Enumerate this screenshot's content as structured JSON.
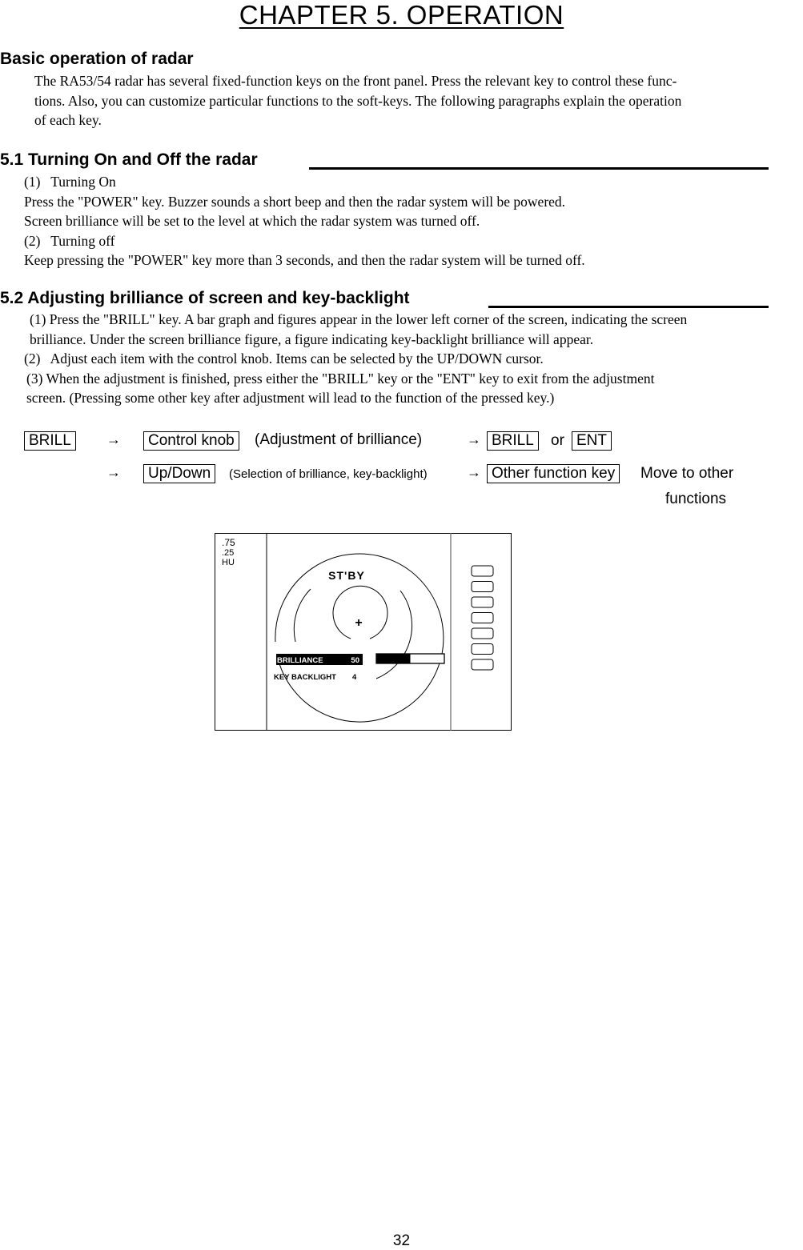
{
  "chapter_title": "CHAPTER 5.  OPERATION",
  "basic": {
    "heading": "Basic operation of radar",
    "lines": [
      "The RA53/54 radar has several fixed-function keys on the front panel. Press the relevant key to control these func-",
      "tions. Also, you can customize particular functions to the soft-keys.  The following paragraphs explain the operation",
      "of each key."
    ]
  },
  "section_5_1": {
    "heading": "5.1 Turning On and Off the radar",
    "lines": [
      "(1)   Turning On",
      "Press the \"POWER\" key. Buzzer sounds a short beep and then the radar system will be powered.",
      "Screen brilliance will be set to the level at which the radar system was turned off.",
      "(2)   Turning off",
      "Keep pressing the \"POWER\" key more than 3 seconds, and then the radar system will be turned off."
    ]
  },
  "section_5_2": {
    "heading": "5.2 Adjusting brilliance of screen and key-backlight",
    "lines": [
      "(1) Press the \"BRILL\" key. A bar graph and figures appear in the lower left corner of the screen, indicating the screen",
      "brilliance. Under the screen brilliance figure, a figure indicating key-backlight brilliance will appear.",
      "(2)   Adjust each item with the control knob. Items can be selected by the UP/DOWN cursor.",
      "(3) When the adjustment is finished, press either the \"BRILL\" key or the \"ENT\" key to exit from the adjustment",
      "screen.  (Pressing some other key after adjustment will lead to the function of the pressed key.)"
    ]
  },
  "flow": {
    "arrow": "→",
    "row1": {
      "key_brill": "BRILL",
      "key_control_knob": "Control knob",
      "desc": "(Adjustment of brilliance)",
      "key_brill_2": "BRILL",
      "or": "or",
      "key_ent": "ENT"
    },
    "row2": {
      "key_updown": "Up/Down",
      "desc": "(Selection of brilliance, key-backlight)",
      "key_other": "Other function key",
      "desc2": "Move to other",
      "desc3": "functions"
    }
  },
  "figure": {
    "range_1": ".75",
    "range_2": ".25",
    "mode": "HU",
    "status": "ST'BY",
    "brilliance_label": "BRILLIANCE",
    "brilliance_value": "50",
    "brilliance_fraction": 0.5,
    "key_backlight_label": "KEY BACKLIGHT",
    "key_backlight_value": "4",
    "softkey_count": 7
  },
  "page_number": "32"
}
